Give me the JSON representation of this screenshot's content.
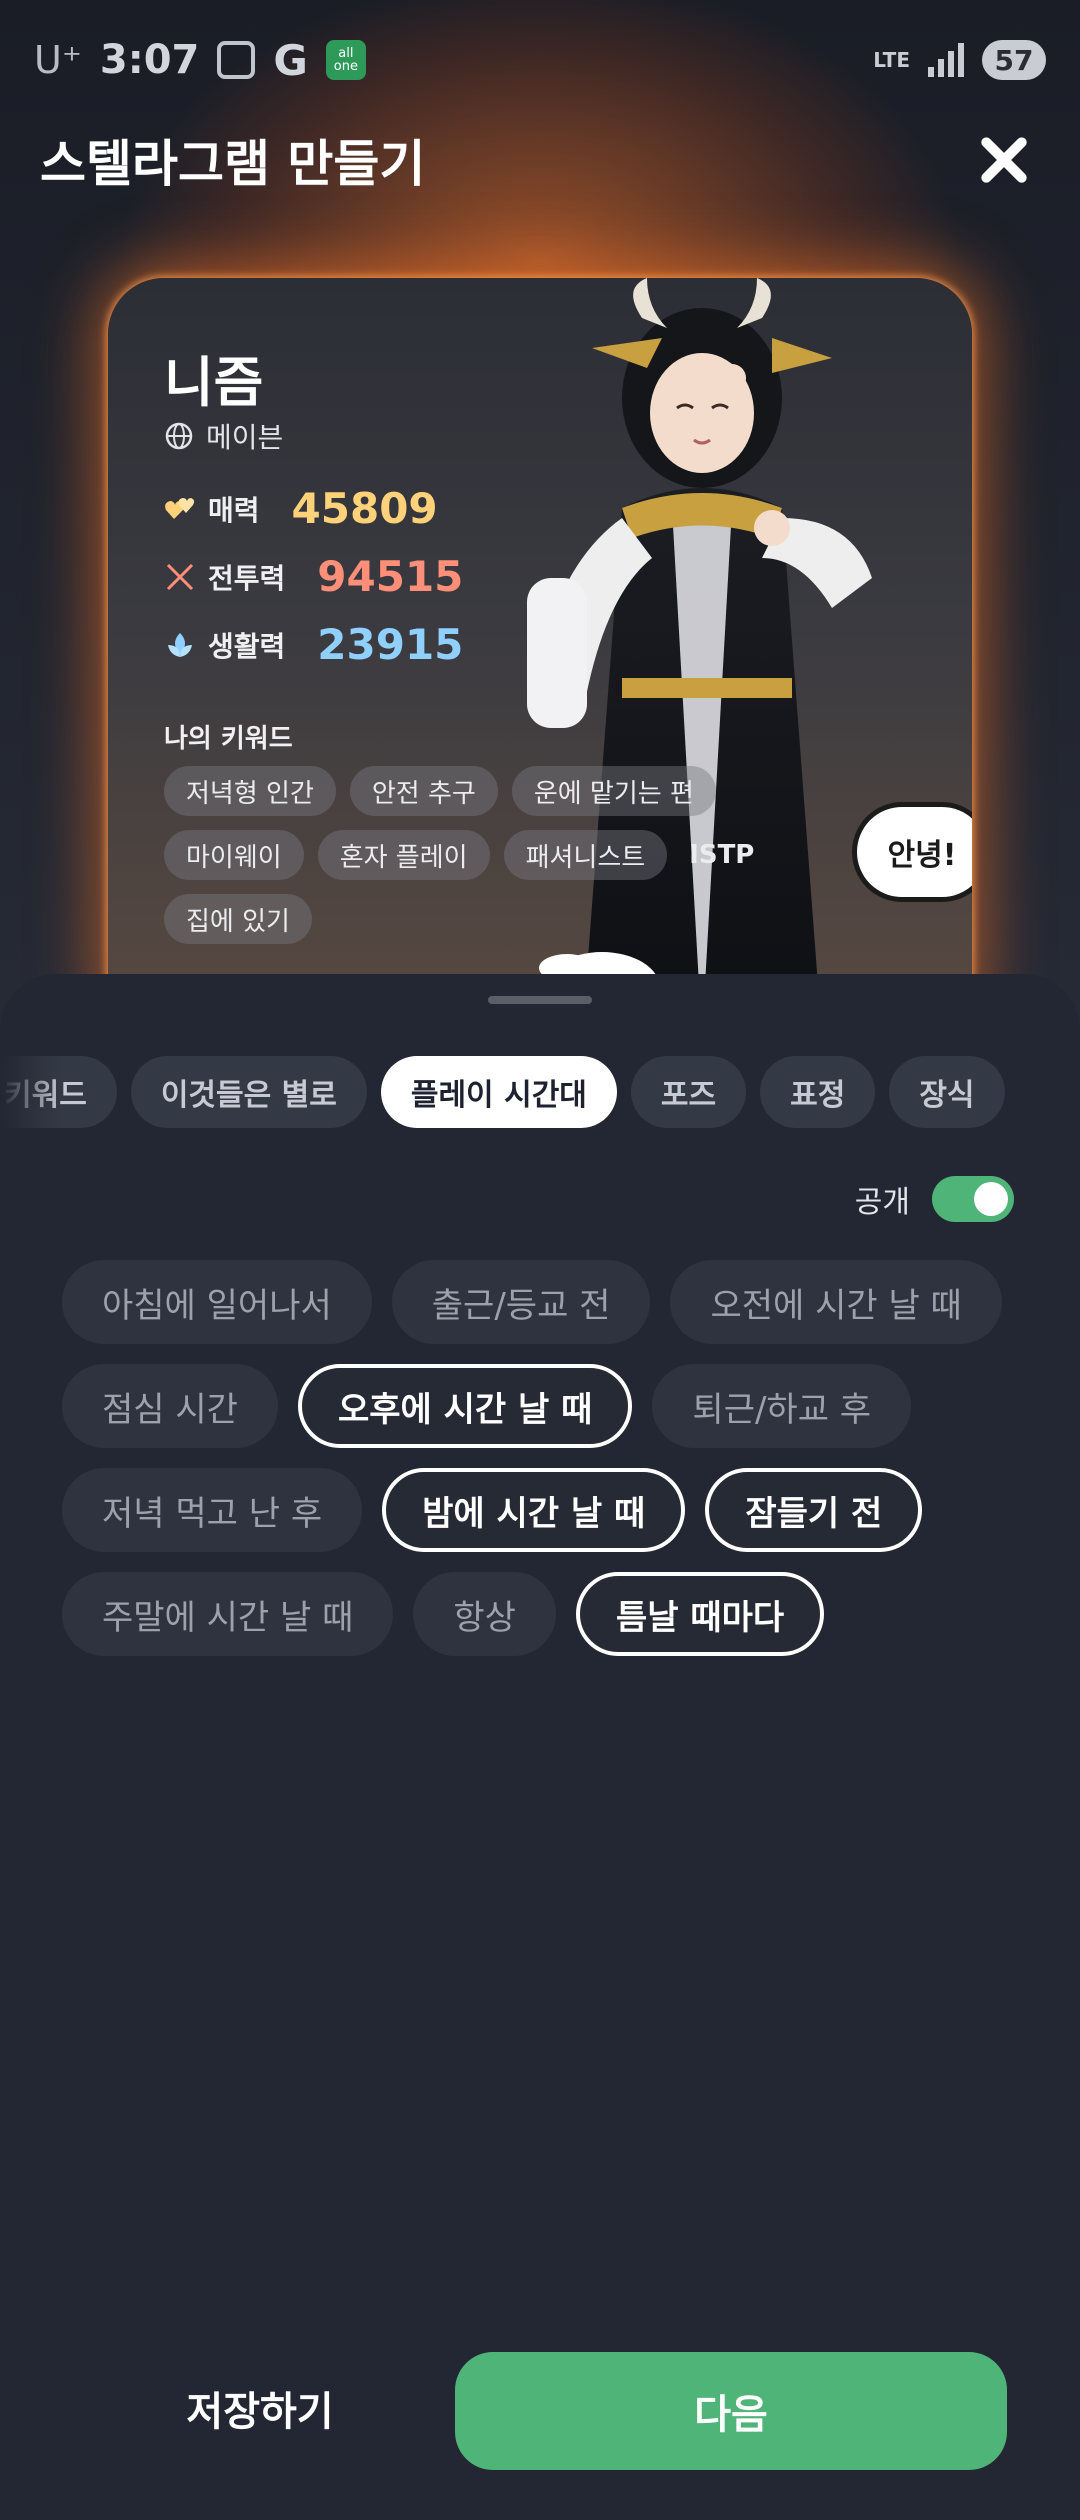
{
  "status_bar": {
    "carrier": "U⁺",
    "time": "3:07",
    "g_label": "G",
    "allone_label": "all one",
    "network": "LTE",
    "battery": "57"
  },
  "header": {
    "title": "스텔라그램 만들기"
  },
  "card": {
    "name": "니즘",
    "server": "메이븐",
    "stats": [
      {
        "label": "매력",
        "value": "45809",
        "color": "#ffd27a"
      },
      {
        "label": "전투력",
        "value": "94515",
        "color": "#ff8f78"
      },
      {
        "label": "생활력",
        "value": "23915",
        "color": "#8fd0ff"
      }
    ],
    "keyword_title": "나의 키워드",
    "keywords": [
      "저녁형 인간",
      "안전 추구",
      "운에 맡기는 편",
      "마이웨이",
      "혼자 플레이",
      "패셔니스트",
      "ISTP",
      "집에 있기"
    ],
    "speech_bubble": "안녕!"
  },
  "tabs": [
    "키워드",
    "이것들은 별로",
    "플레이 시간대",
    "포즈",
    "표정",
    "장식"
  ],
  "active_tab": "플레이 시간대",
  "public_label": "공개",
  "options": [
    {
      "label": "아침에 일어나서",
      "selected": false
    },
    {
      "label": "출근/등교 전",
      "selected": false
    },
    {
      "label": "오전에 시간 날 때",
      "selected": false
    },
    {
      "label": "점심 시간",
      "selected": false
    },
    {
      "label": "오후에 시간 날 때",
      "selected": true
    },
    {
      "label": "퇴근/하교 후",
      "selected": false
    },
    {
      "label": "저녁 먹고 난 후",
      "selected": false
    },
    {
      "label": "밤에 시간 날 때",
      "selected": true
    },
    {
      "label": "잠들기 전",
      "selected": true
    },
    {
      "label": "주말에 시간 날 때",
      "selected": false
    },
    {
      "label": "항상",
      "selected": false
    },
    {
      "label": "틈날 때마다",
      "selected": true
    }
  ],
  "buttons": {
    "save": "저장하기",
    "next": "다음"
  },
  "colors": {
    "accent_green": "#4fb477",
    "sheet_bg": "#232733",
    "chip_bg": "#2e333f"
  }
}
